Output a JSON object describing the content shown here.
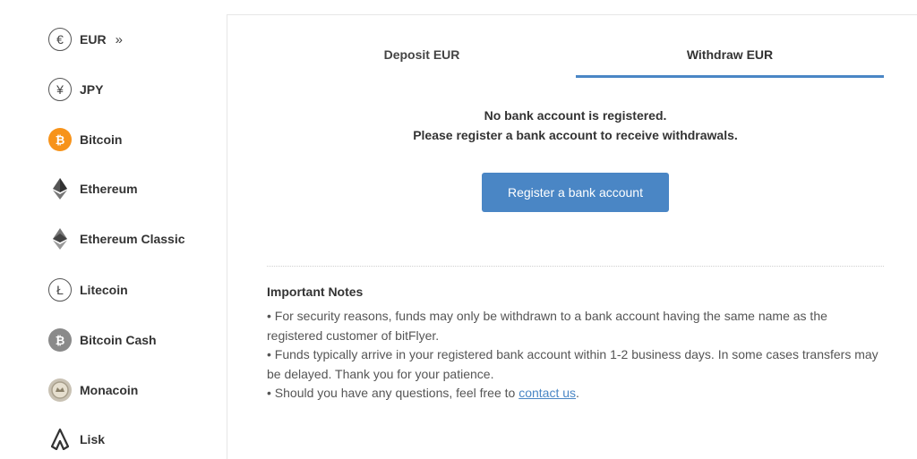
{
  "sidebar": {
    "items": [
      {
        "label": "EUR",
        "icon": "euro-icon",
        "glyph": "€",
        "active": true,
        "chevron": "»"
      },
      {
        "label": "JPY",
        "icon": "yen-icon",
        "glyph": "¥"
      },
      {
        "label": "Bitcoin",
        "icon": "bitcoin-icon",
        "glyph": "₿"
      },
      {
        "label": "Ethereum",
        "icon": "ethereum-icon"
      },
      {
        "label": "Ethereum Classic",
        "icon": "ethereum-classic-icon"
      },
      {
        "label": "Litecoin",
        "icon": "litecoin-icon",
        "glyph": "Ł"
      },
      {
        "label": "Bitcoin Cash",
        "icon": "bitcoin-cash-icon",
        "glyph": "₿"
      },
      {
        "label": "Monacoin",
        "icon": "monacoin-icon"
      },
      {
        "label": "Lisk",
        "icon": "lisk-icon"
      }
    ]
  },
  "tabs": {
    "deposit_label": "Deposit EUR",
    "withdraw_label": "Withdraw EUR",
    "active": "withdraw"
  },
  "main": {
    "message_line1": "No bank account is registered.",
    "message_line2": "Please register a bank account to receive withdrawals.",
    "register_button_label": "Register a bank account"
  },
  "notes": {
    "title": "Important Notes",
    "item1": "• For security reasons, funds may only be withdrawn to a bank account having the same name as the registered customer of bitFlyer.",
    "item2": "• Funds typically arrive in your registered bank account within 1-2 business days. In some cases transfers may be delayed. Thank you for your patience.",
    "item3_prefix": "• Should you have any questions, feel free to ",
    "item3_link": "contact us",
    "item3_suffix": "."
  },
  "colors": {
    "accent": "#4a86c5",
    "bitcoin": "#f7931a"
  }
}
